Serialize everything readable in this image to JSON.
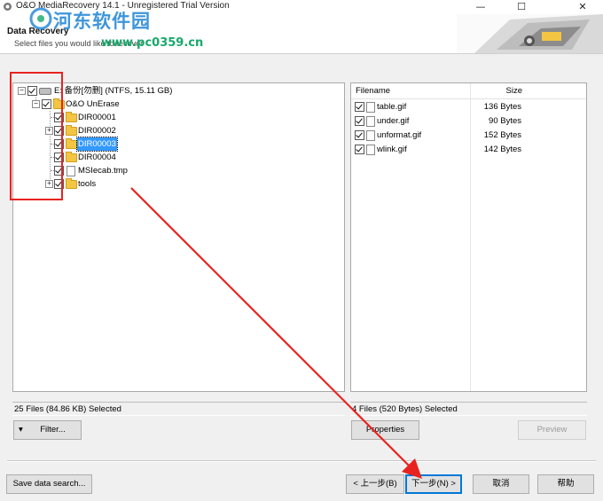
{
  "window": {
    "title": "O&O MediaRecovery 14.1 - Unregistered Trial Version",
    "minimize": "—",
    "maximize": "☐",
    "close": "✕"
  },
  "header": {
    "title": "Data Recovery",
    "subtitle": "Select files you would like to recover"
  },
  "watermark": {
    "text": "河东软件园",
    "url": "www.pc0359.cn"
  },
  "tree": {
    "root": "E: 备份[勿删] (NTFS, 15.11 GB)",
    "items": [
      {
        "label": "O&O UnErase"
      },
      {
        "label": "DIR00001"
      },
      {
        "label": "DIR00002"
      },
      {
        "label": "DIR00003"
      },
      {
        "label": "DIR00004"
      },
      {
        "label": "MSIecab.tmp"
      },
      {
        "label": "tools"
      }
    ]
  },
  "list": {
    "columns": {
      "name": "Filename",
      "size": "Size"
    },
    "rows": [
      {
        "name": "table.gif",
        "size": "136 Bytes"
      },
      {
        "name": "under.gif",
        "size": "90 Bytes"
      },
      {
        "name": "unformat.gif",
        "size": "152 Bytes"
      },
      {
        "name": "wlink.gif",
        "size": "142 Bytes"
      }
    ]
  },
  "status": {
    "left": "25 Files (84.86 KB) Selected",
    "right": "4 Files (520 Bytes) Selected"
  },
  "buttons": {
    "filter": "Filter...",
    "filter_arrow": "▾",
    "properties": "Properties",
    "preview": "Preview",
    "save_search": "Save data search...",
    "back": "< 上一步(B)",
    "next": "下一步(N) >",
    "cancel": "取消",
    "help": "帮助"
  },
  "colors": {
    "annotation": "#e8231f",
    "selection": "#3399ff",
    "watermark": "#1d83d4"
  }
}
